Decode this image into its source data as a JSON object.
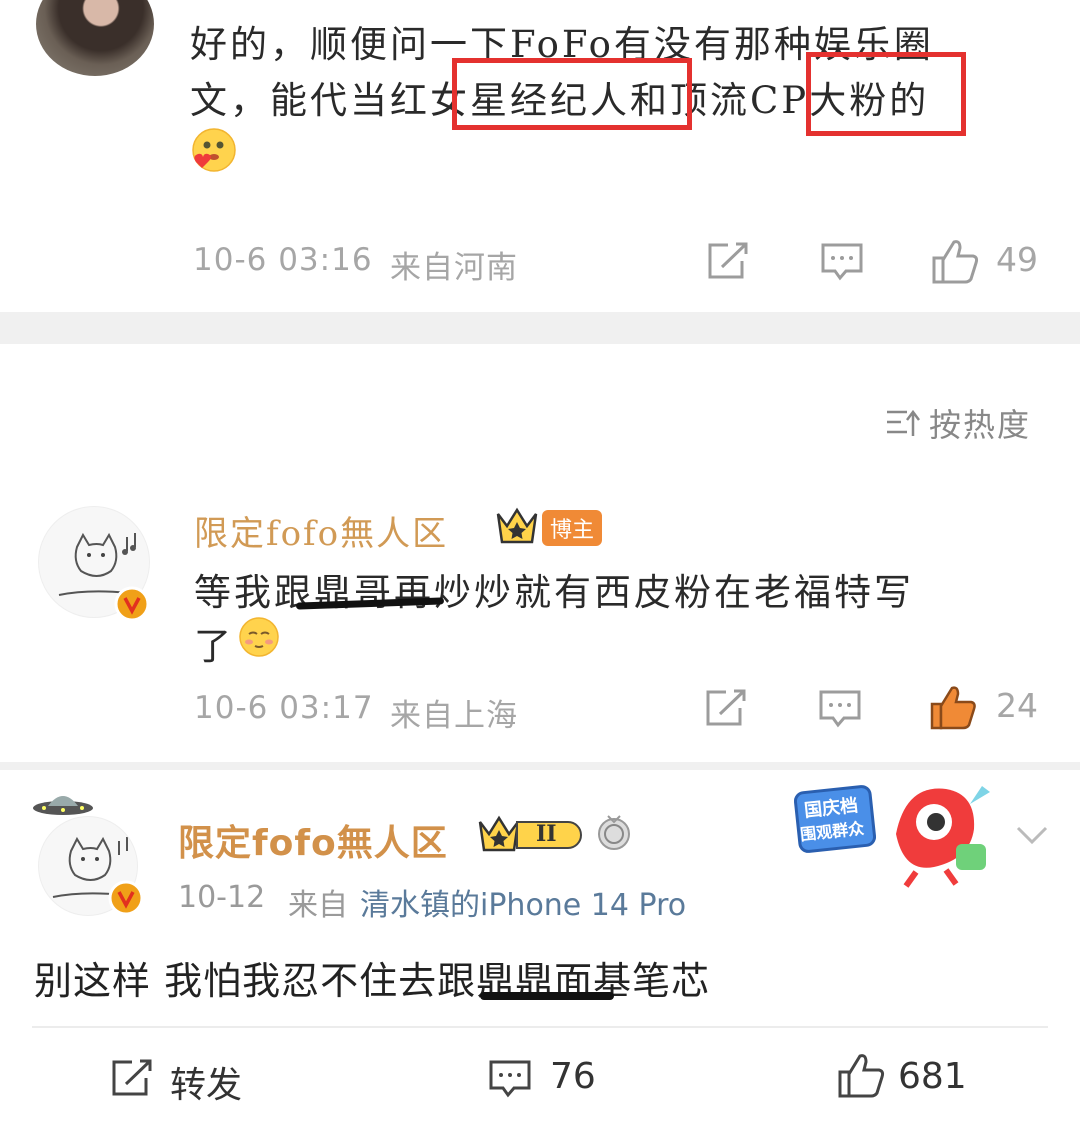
{
  "comment1": {
    "text_line1": "好的，顺便问一下FoFo有没有那种娱乐圈",
    "text_line2": "文，能代当红女星经纪人和顶流CP大粉的",
    "time": "10-6 03:16",
    "location": "来自河南",
    "likes": "49"
  },
  "sort": {
    "label": "按热度"
  },
  "comment2": {
    "username": "限定fofo無人区",
    "badge": "博主",
    "text_line1": "等我跟鼎哥再炒炒就有西皮粉在老福特写",
    "text_line2": "了",
    "time": "10-6 03:17",
    "location": "来自上海",
    "likes": "24"
  },
  "post": {
    "username": "限定fofo無人区",
    "level": "II",
    "date": "10-12",
    "source_prefix": "来自",
    "source_device": "清水镇的iPhone 14 Pro",
    "body": "别这样 我怕我忍不住去跟鼎鼎面基笔芯",
    "promo_line1": "国庆档",
    "promo_line2": "围观群众",
    "actions": {
      "repost_label": "转发",
      "comments_count": "76",
      "likes_count": "681"
    }
  },
  "colors": {
    "username": "#d19a55",
    "liked": "#f08a36",
    "highlight_box": "#e4312f",
    "meta_gray": "#a6a6a6"
  }
}
